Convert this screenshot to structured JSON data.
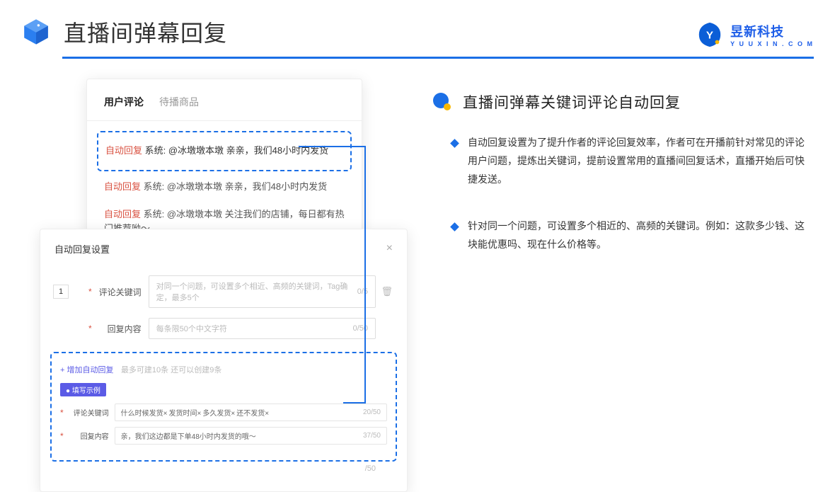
{
  "header": {
    "title": "直播间弹幕回复",
    "brand_cn": "昱新科技",
    "brand_en": "Y U U X I N . C O M"
  },
  "panel_top": {
    "tabs": {
      "active": "用户评论",
      "inactive": "待播商品"
    },
    "highlighted": {
      "badge": "自动回复",
      "text": " 系统: @冰墩墩本墩 亲亲，我们48小时内发货"
    },
    "c2": {
      "badge": "自动回复",
      "text": " 系统: @冰墩墩本墩 亲亲，我们48小时内发货"
    },
    "c3": {
      "badge": "自动回复",
      "text": " 系统: @冰墩墩本墩 关注我们的店铺，每日都有热门推荐呦～"
    }
  },
  "panel_bot": {
    "title": "自动回复设置",
    "order": "1",
    "row1": {
      "label": "评论关键词",
      "placeholder": "对同一个问题，可设置多个相近、高频的关键词，Tag确定，最多5个",
      "count": "0/5"
    },
    "row2": {
      "label": "回复内容",
      "placeholder": "每条限50个中文字符",
      "count": "0/50"
    },
    "add": {
      "link": "+ 增加自动回复",
      "tip": "最多可建10条 还可以创建9条"
    },
    "pill": "● 填写示例",
    "ex1": {
      "label": "评论关键词",
      "t1": "什么时候发货×",
      "t2": "发货时间×",
      "t3": "多久发货×",
      "t4": "还不发货×",
      "count": "20/50"
    },
    "ex2": {
      "label": "回复内容",
      "text": "亲，我们这边都是下单48小时内发货的哦～",
      "count": "37/50"
    },
    "tail_count": "/50"
  },
  "right": {
    "title": "直播间弹幕关键词评论自动回复",
    "b1": "自动回复设置为了提升作者的评论回复效率，作者可在开播前针对常见的评论用户问题，提炼出关键词，提前设置常用的直播间回复话术，直播开始后可快捷发送。",
    "b2": "针对同一个问题，可设置多个相近的、高频的关键词。例如：这款多少钱、这块能优惠吗、现在什么价格等。"
  }
}
